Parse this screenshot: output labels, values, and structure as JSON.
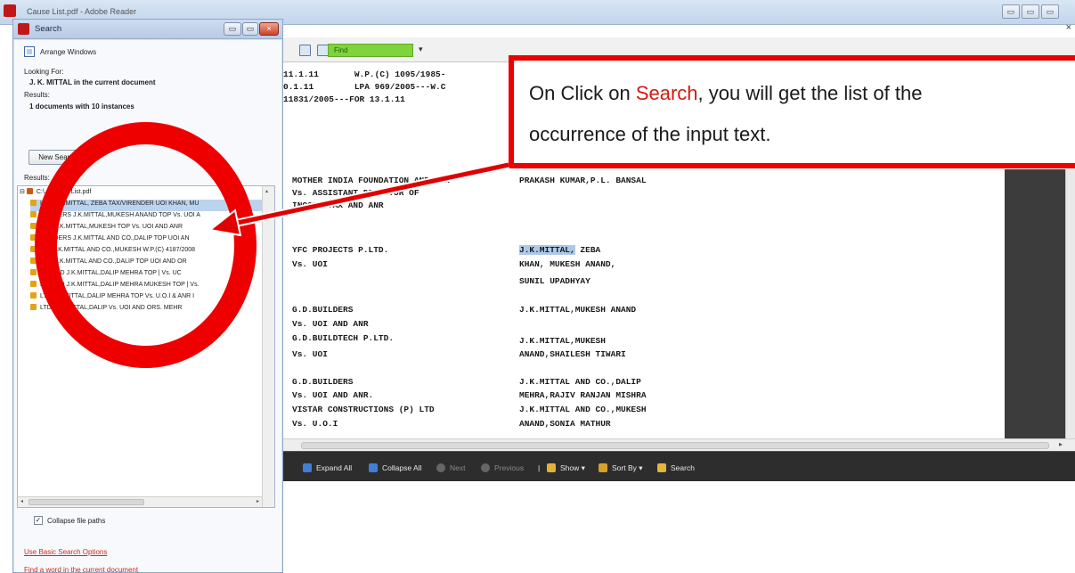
{
  "app": {
    "title": "Cause List.pdf - Adobe Reader",
    "window_buttons": [
      "▭",
      "▭",
      "▭"
    ],
    "close_glyph": "×"
  },
  "toolbar": {
    "find_placeholder": "Find",
    "find_dropdown": "▾"
  },
  "document": {
    "lines": [
      "11.1.11       W.P.(C) 1095/1985-",
      "0.1.11        LPA 969/2005---W.C",
      "11831/2005---FOR 13.1.11"
    ],
    "cases": [
      {
        "left": "MOTHER INDIA FOUNDATION AND ANR",
        "right": "PRAKASH KUMAR,P.L. BANSAL"
      },
      {
        "left": "Vs. ASSISTANT DIRECTOR OF",
        "right": ""
      },
      {
        "left": "INCOME TAX AND ANR",
        "right": ""
      },
      {
        "left": "YFC PROJECTS P.LTD.",
        "right_highlight": "J.K.MITTAL,",
        "right": " ZEBA"
      },
      {
        "left": "Vs. UOI",
        "right": "KHAN, MUKESH ANAND,"
      },
      {
        "left": "",
        "right": "SUNIL UPADHYAY"
      },
      {
        "left": "G.D.BUILDERS",
        "right": "J.K.MITTAL,MUKESH ANAND"
      },
      {
        "left": "Vs. UOI AND ANR",
        "right": ""
      },
      {
        "left": "G.D.BUILDTECH P.LTD.",
        "right": "J.K.MITTAL,MUKESH"
      },
      {
        "left": "Vs. UOI",
        "right": "ANAND,SHAILESH TIWARI"
      },
      {
        "left": "G.D.BUILDERS",
        "right": "J.K.MITTAL AND CO.,DALIP"
      },
      {
        "left": "Vs. UOI AND ANR.",
        "right": "MEHRA,RAJIV RANJAN MISHRA"
      },
      {
        "left": "VISTAR CONSTRUCTIONS (P) LTD",
        "right": "J.K.MITTAL AND CO.,MUKESH"
      },
      {
        "left": "Vs. U.O.I",
        "right": "ANAND,SONIA MATHUR"
      }
    ]
  },
  "bottombar": {
    "expand_all": "Expand All",
    "collapse_all": "Collapse All",
    "next": "Next",
    "previous": "Previous",
    "separator": "|",
    "show": "Show ▾",
    "sort_by": "Sort By ▾",
    "search": "Search"
  },
  "panel": {
    "title": "Search",
    "arrange_windows": "Arrange Windows",
    "looking_for_label": "Looking For:",
    "looking_for_value": "J. K. MITTAL in the current document",
    "results_label": "Results:",
    "results_value": "1 documents with 10 instances",
    "new_search": "New Search",
    "results_list_label": "Results:",
    "file_node": "C:\\...\\Cause List.pdf",
    "result_rows": [
      "LTD. J.K.MITTAL, ZEBA TAX/VIRENDER UOI KHAN, MU",
      "BUILDERS J.K.MITTAL,MUKESH ANAND TOP Vs. UOI A",
      "LTD. J.K.MITTAL,MUKESH TOP Vs. UOI AND ANR",
      "BUILDERS J.K.MITTAL AND CO.,DALIP TOP UOI AN",
      "LTD J.K.MITTAL AND CO.,MUKESH W.P.(C) 4187/2008",
      "LTD. J.K.MITTAL AND CO.,DALIP TOP UOI AND OR",
      "LIMITED J.K.MITTAL,DALIP MEHRA TOP | Vs. UC",
      "LIMITED J.K.MITTAL,DALIP MEHRA MUKESH TOP | Vs.",
      "LTD J.K.MITTAL,DALIP MEHRA TOP Vs. U.O.I & ANR I",
      "LTD. J.K.MITTAL,DALIP Vs. UOI AND ORS. MEHR"
    ],
    "collapse_file_paths": "Collapse file paths",
    "checkbox_mark": "✓",
    "use_basic_search": "Use Basic Search Options",
    "find_word": "Find a word in the current document",
    "scroll_left": "◂",
    "scroll_right": "▸",
    "scroll_up": "▴"
  },
  "callout": {
    "prefix": "On Click on ",
    "highlight": "Search",
    "rest_line1": ", you will get the list of the",
    "line2": "occurrence of the input text."
  },
  "colors": {
    "annotation_red": "#ee0000",
    "find_box_green": "#7ed43a",
    "selection_blue": "#bcd3ee"
  }
}
